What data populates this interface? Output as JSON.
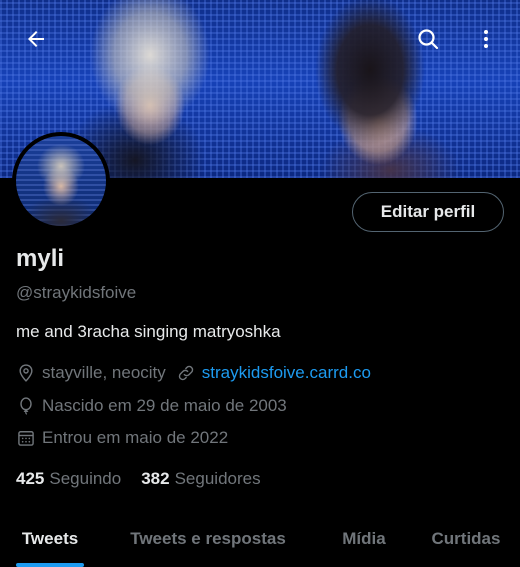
{
  "header": {
    "back_icon": "arrow-left-icon",
    "search_icon": "search-icon",
    "more_icon": "more-vertical-icon"
  },
  "profile": {
    "edit_button_label": "Editar perfil",
    "name": "myli",
    "handle": "@straykidsfoive",
    "bio": "me and 3racha singing matryoshka",
    "location": "stayville, neocity",
    "website": "straykidsfoive.carrd.co",
    "birthday": "Nascido em 29 de maio de 2003",
    "joined": "Entrou em maio de 2022",
    "following_count": "425",
    "following_label": "Seguindo",
    "followers_count": "382",
    "followers_label": "Seguidores"
  },
  "tabs": [
    {
      "label": "Tweets",
      "active": true
    },
    {
      "label": "Tweets e respostas",
      "active": false
    },
    {
      "label": "Mídia",
      "active": false
    },
    {
      "label": "Curtidas",
      "active": false
    }
  ],
  "colors": {
    "accent": "#1d9bf0",
    "text_primary": "#e7e9ea",
    "text_secondary": "#71767b",
    "background": "#000000"
  }
}
